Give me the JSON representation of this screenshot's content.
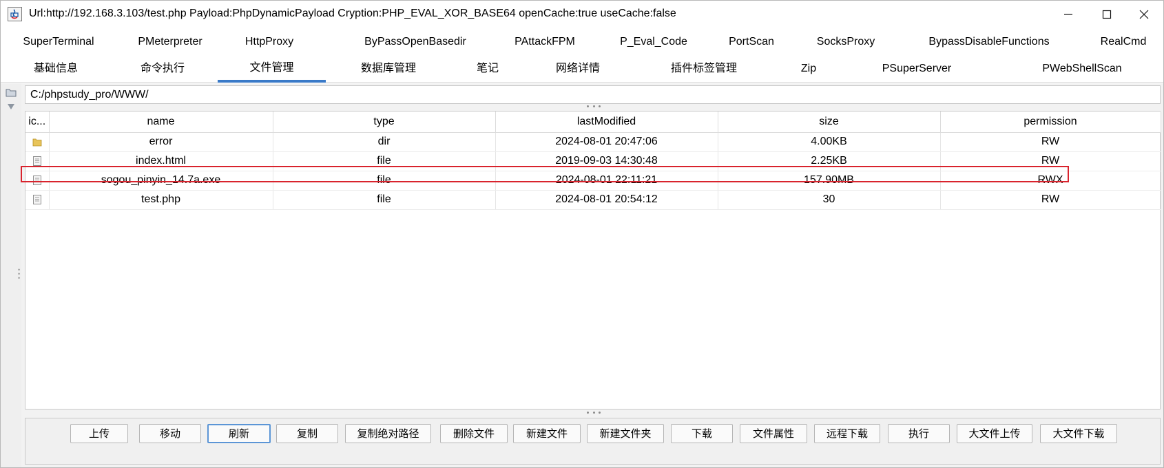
{
  "window": {
    "title": "Url:http://192.168.3.103/test.php Payload:PhpDynamicPayload Cryption:PHP_EVAL_XOR_BASE64 openCache:true useCache:false"
  },
  "tabs": {
    "row1": [
      "SuperTerminal",
      "PMeterpreter",
      "HttpProxy",
      "ByPassOpenBasedir",
      "PAttackFPM",
      "P_Eval_Code",
      "PortScan",
      "SocksProxy",
      "BypassDisableFunctions",
      "RealCmd"
    ],
    "row2": [
      "基础信息",
      "命令执行",
      "文件管理",
      "数据库管理",
      "笔记",
      "网络详情",
      "插件标签管理",
      "Zip",
      "PSuperServer",
      "PWebShellScan"
    ],
    "active": "文件管理"
  },
  "path": "C:/phpstudy_pro/WWW/",
  "table": {
    "columns": [
      "ic...",
      "name",
      "type",
      "lastModified",
      "size",
      "permission"
    ],
    "rows": [
      {
        "icon": "folder-icon",
        "name": "error",
        "type": "dir",
        "lastModified": "2024-08-01 20:47:06",
        "size": "4.00KB",
        "permission": "RW"
      },
      {
        "icon": "file-icon",
        "name": "index.html",
        "type": "file",
        "lastModified": "2019-09-03 14:30:48",
        "size": "2.25KB",
        "permission": "RW"
      },
      {
        "icon": "file-icon",
        "name": "sogou_pinyin_14.7a.exe",
        "type": "file",
        "lastModified": "2024-08-01 22:11:21",
        "size": "157.90MB",
        "permission": "RWX"
      },
      {
        "icon": "file-icon",
        "name": "test.php",
        "type": "file",
        "lastModified": "2024-08-01 20:54:12",
        "size": "30",
        "permission": "RW"
      }
    ]
  },
  "buttons": [
    "上传",
    "移动",
    "刷新",
    "复制",
    "复制绝对路径",
    "删除文件",
    "新建文件",
    "新建文件夹",
    "下载",
    "文件属性",
    "远程下载",
    "执行",
    "大文件上传",
    "大文件下载"
  ],
  "colors": {
    "accent": "#3a7ac8",
    "highlight": "#d9232d",
    "folder": "#e8c45a"
  }
}
